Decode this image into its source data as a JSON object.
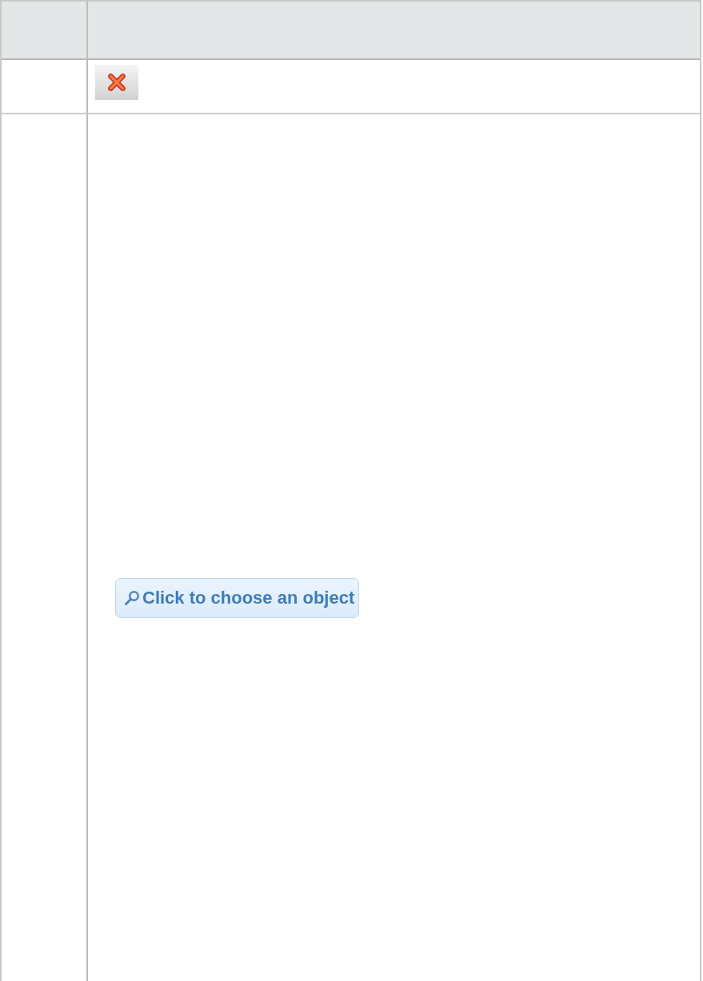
{
  "rows": [
    {
      "kind": "delete"
    },
    {
      "kind": "chooser",
      "button": {
        "label": "Click to choose an object"
      }
    }
  ]
}
